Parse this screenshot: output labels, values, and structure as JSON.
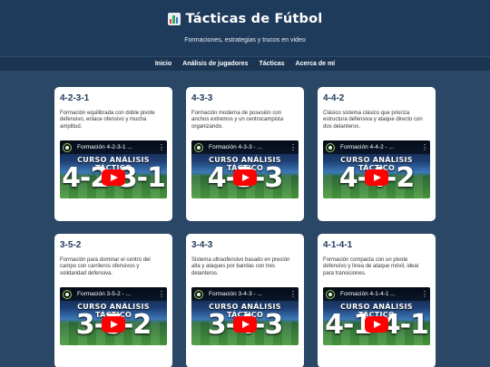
{
  "header": {
    "title": "Tácticas de Fútbol",
    "icon": "bar-chart-icon",
    "subtitle": "Formaciones, estrategias y trucos en video"
  },
  "nav": {
    "items": [
      "Inicio",
      "Análisis de jugadores",
      "Tácticas",
      "Acerca de mí"
    ]
  },
  "video_common": {
    "course_label": "CURSO ANÁLISIS TÁCTICO",
    "menu_glyph": "⋮"
  },
  "cards": [
    {
      "title": "4-2-3-1",
      "description": "Formación equilibrada con doble pivote defensivo, enlace ofensivo y mucha amplitud.",
      "video_title": "Formación 4-2-3-1 ...",
      "thumb_text": "4-2-3-1"
    },
    {
      "title": "4-3-3",
      "description": "Formación moderna de posesión con anchos extremos y un centrocampista organizando.",
      "video_title": "Formación 4-3-3 - ...",
      "thumb_text": "4-3-3"
    },
    {
      "title": "4-4-2",
      "description": "Clásico sistema clásico que prioriza estructura defensiva y ataque directo con dos delanteros.",
      "video_title": "Formación 4-4-2 - ...",
      "thumb_text": "4-4-2"
    },
    {
      "title": "3-5-2",
      "description": "Formación para dominar el centro del campo con carrileros ofensivos y solidaridad defensiva.",
      "video_title": "Formación 3-5-2 - ...",
      "thumb_text": "3-5-2"
    },
    {
      "title": "3-4-3",
      "description": "Sistema ultraofensivo basado en presión alta y ataques por bandas con tres delanteros.",
      "video_title": "Formación 3-4-3 - ...",
      "thumb_text": "3-4-3"
    },
    {
      "title": "4-1-4-1",
      "description": "Formación compacta con un pivote defensivo y línea de ataque móvil, ideal para transiciones.",
      "video_title": "Formación 4-1-4-1 ...",
      "thumb_text": "4-1-4-1"
    }
  ]
}
